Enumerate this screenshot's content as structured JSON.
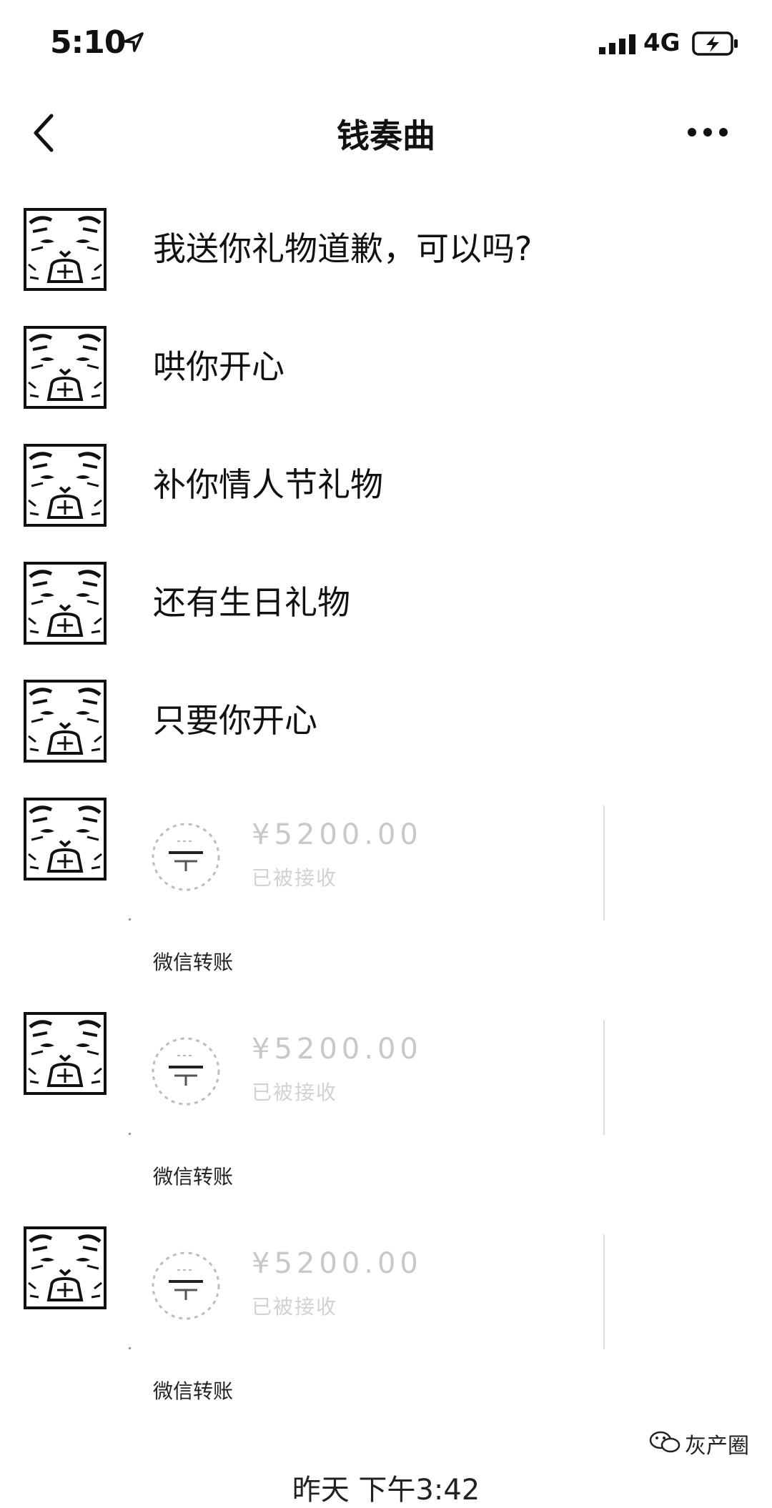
{
  "status_bar": {
    "time": "5:10",
    "network": "4G",
    "icons": [
      "location-arrow-icon",
      "signal-bars-icon",
      "battery-charging-icon"
    ]
  },
  "nav": {
    "title": "钱奏曲",
    "icons": [
      "back-chevron-icon",
      "more-dots-icon"
    ]
  },
  "messages": [
    {
      "type": "text",
      "text": "我送你礼物道歉，可以吗?"
    },
    {
      "type": "text",
      "text": "哄你开心"
    },
    {
      "type": "text",
      "text": "补你情人节礼物"
    },
    {
      "type": "text",
      "text": "还有生日礼物"
    },
    {
      "type": "text",
      "text": "只要你开心"
    },
    {
      "type": "transfer",
      "amount": "¥5200.00",
      "status": "已被接收",
      "label": "微信转账"
    },
    {
      "type": "transfer",
      "amount": "¥5200.00",
      "status": "已被接收",
      "label": "微信转账"
    },
    {
      "type": "transfer",
      "amount": "¥5200.00",
      "status": "已被接收",
      "label": "微信转账"
    }
  ],
  "watermark": {
    "text": "灰产圈",
    "icon": "wechat-logo-icon"
  },
  "time_divider": "昨天 下午3:42",
  "colors": {
    "background": "#ffffff",
    "text": "#111111",
    "faded_transfer_text": "#c8c8c8"
  }
}
